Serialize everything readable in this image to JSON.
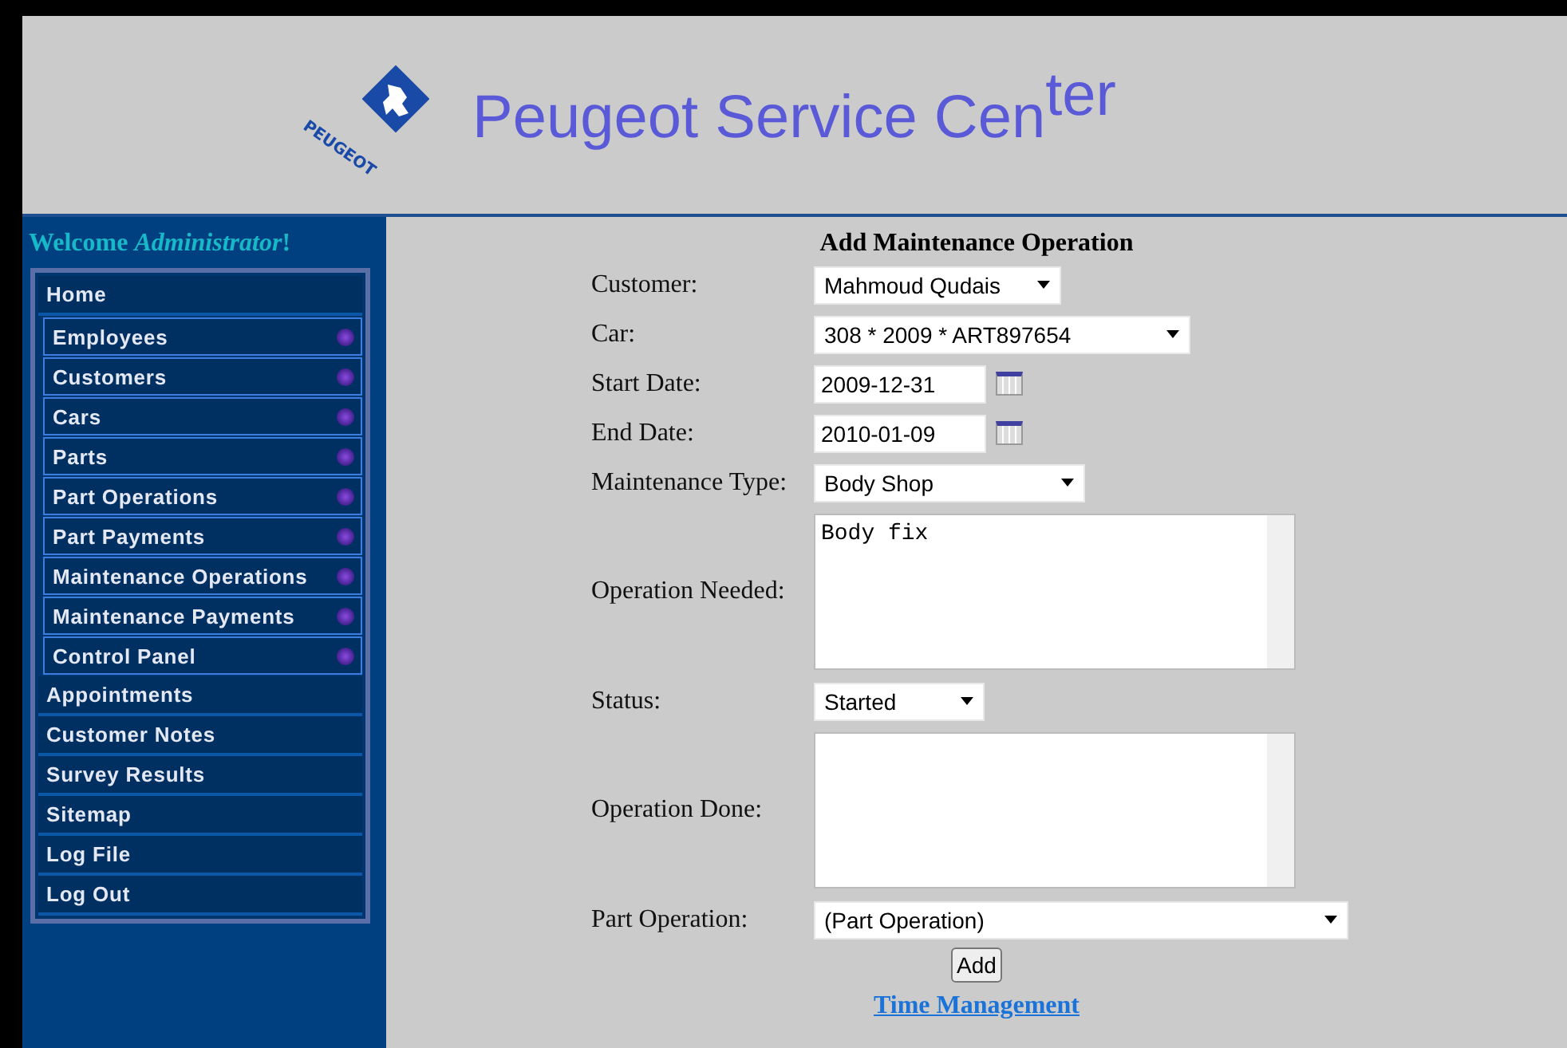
{
  "header": {
    "logo_text": "PEUGEOT",
    "title": "Peugeot Service Cen$^{ter}$"
  },
  "sidebar": {
    "welcome": "Welcome *Administrator*!",
    "items": [
      {
        "label": "Home",
        "submenu": false
      },
      {
        "label": "Employees",
        "submenu": true
      },
      {
        "label": "Customers",
        "submenu": true
      },
      {
        "label": "Cars",
        "submenu": true
      },
      {
        "label": "Parts",
        "submenu": true
      },
      {
        "label": "Part Operations",
        "submenu": true
      },
      {
        "label": "Part Payments",
        "submenu": true
      },
      {
        "label": "Maintenance Operations",
        "submenu": true
      },
      {
        "label": "Maintenance Payments",
        "submenu": true
      },
      {
        "label": "Control Panel",
        "submenu": true
      },
      {
        "label": "Appointments",
        "submenu": false
      },
      {
        "label": "Customer Notes",
        "submenu": false
      },
      {
        "label": "Survey Results",
        "submenu": false
      },
      {
        "label": "Sitemap",
        "submenu": false
      },
      {
        "label": "Log File",
        "submenu": false
      },
      {
        "label": "Log Out",
        "submenu": false
      }
    ]
  },
  "form": {
    "title": "Add Maintenance Operation",
    "fields": [
      {
        "label": "Customer:",
        "kind": "select",
        "value": "Mahmoud Qudais"
      },
      {
        "label": "Car:",
        "kind": "select",
        "value": "308 * 2009 * ART897654"
      },
      {
        "label": "Start Date:",
        "kind": "date",
        "value": "2009-12-31"
      },
      {
        "label": "End Date:",
        "kind": "date",
        "value": "2010-01-09"
      },
      {
        "label": "Maintenance Type:",
        "kind": "select",
        "value": "Body Shop"
      },
      {
        "label": "Operation Needed:",
        "kind": "textarea",
        "value": "Body fix"
      },
      {
        "label": "Status:",
        "kind": "select",
        "value": "Started"
      },
      {
        "label": "Operation Done:",
        "kind": "textarea"
      },
      {
        "label": "Part Operation:",
        "kind": "select",
        "value": "(Part Operation)"
      }
    ],
    "button": "Add",
    "link": "Time Management"
  }
}
